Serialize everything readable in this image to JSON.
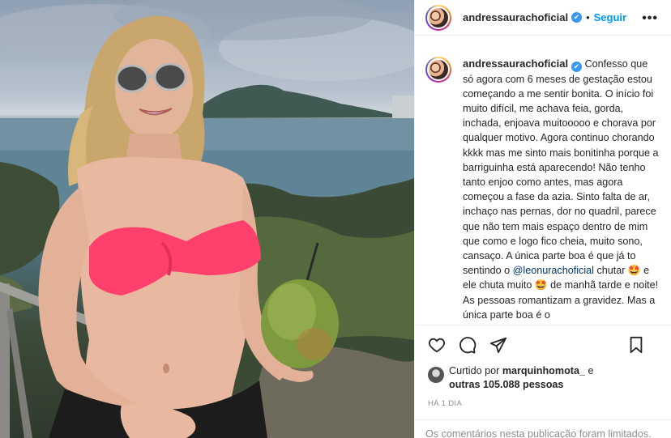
{
  "post": {
    "image_alt": "",
    "username": "andressaurachoficial",
    "verified_mark": "✔",
    "separator": "•",
    "follow_label": "Seguir",
    "more_label": "•••",
    "caption_parts": [
      "Confesso que só agora com 6 meses de gestação estou começando a me sentir bonita. O início foi muito difícil, me achava feia, gorda, inchada, enjoava muitooooo e chorava por qualquer motivo. Agora continuo chorando kkkk mas me sinto mais bonitinha porque a barriguinha está aparecendo! Não tenho tanto enjoo como antes, mas agora começou a fase da azia. Sinto falta de ar, inchaço nas pernas, dor no quadril, parece que não tem mais espaço dentro de mim que como e logo fico cheia, muito sono, cansaço. A única parte boa é que já to sentindo o ",
      "@leonurachoficial",
      " chutar 🤩 e ele chuta muito 🤩 de manhã tarde e noite! As pessoas romantizam a gravidez. Mas a única parte boa é o"
    ],
    "likes": {
      "prefix": "Curtido por ",
      "user": "marquinhomota_",
      "middle": " e",
      "count_text": "outras 105.088 pessoas"
    },
    "time_ago": "HÁ 1 DIA",
    "comments_note": "Os comentários nesta publicação foram limitados."
  },
  "icons": {
    "like": "heart-outline-icon",
    "comment": "comment-bubble-icon",
    "share": "paper-plane-icon",
    "save": "bookmark-icon"
  },
  "colors": {
    "link_blue": "#0095f6",
    "verified_blue": "#3897f0",
    "muted": "#8e8e8e",
    "text": "#262626"
  }
}
